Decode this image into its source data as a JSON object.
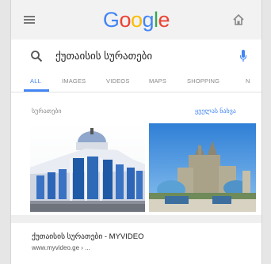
{
  "header": {
    "logo_letters": [
      {
        "ch": "G",
        "color": "#4285f4"
      },
      {
        "ch": "o",
        "color": "#ea4335"
      },
      {
        "ch": "o",
        "color": "#fbbc05"
      },
      {
        "ch": "g",
        "color": "#4285f4"
      },
      {
        "ch": "l",
        "color": "#34a853"
      },
      {
        "ch": "e",
        "color": "#ea4335"
      }
    ],
    "menu_icon": "hamburger-icon",
    "home_icon": "home-icon"
  },
  "search": {
    "query": "ქუთაისის სურათები",
    "search_icon": "search-icon",
    "mic_icon": "mic-icon"
  },
  "tabs": [
    "ALL",
    "IMAGES",
    "VIDEOS",
    "MAPS",
    "SHOPPING",
    "N"
  ],
  "images_card": {
    "title": "სურათები",
    "more_link": "ყველას ნახვა"
  },
  "result": {
    "title": "ქუთაისის სურათები - MYVIDEO",
    "url": "www.myvideo.ge › ..."
  },
  "colors": {
    "accent": "#4285f4",
    "topbar_bg": "#f2f2f2",
    "page_bg": "#efefef"
  }
}
